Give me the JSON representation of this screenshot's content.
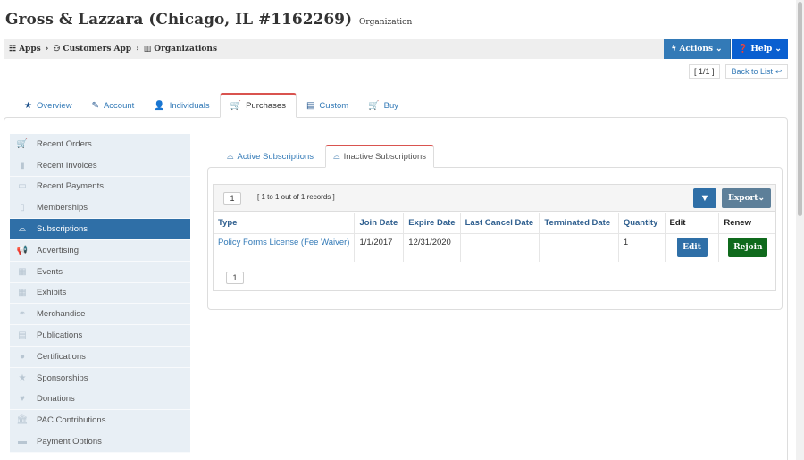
{
  "header": {
    "title": "Gross & Lazzara (Chicago, IL #1162269)",
    "subtitle": "Organization"
  },
  "breadcrumb": {
    "items": [
      {
        "label": "Apps",
        "icon": "grid-icon"
      },
      {
        "label": "Customers App",
        "icon": "users-icon"
      },
      {
        "label": "Organizations",
        "icon": "building-icon"
      }
    ],
    "separator": "›"
  },
  "toolbar": {
    "actions_label": "Actions",
    "help_label": "Help",
    "pager_label": "[ 1/1 ]",
    "back_label": "Back to List"
  },
  "main_tabs": [
    {
      "label": "Overview",
      "icon": "star-icon"
    },
    {
      "label": "Account",
      "icon": "edit-icon"
    },
    {
      "label": "Individuals",
      "icon": "user-icon"
    },
    {
      "label": "Purchases",
      "icon": "cart-icon"
    },
    {
      "label": "Custom",
      "icon": "file-icon"
    },
    {
      "label": "Buy",
      "icon": "cart-icon"
    }
  ],
  "sidebar": {
    "items": [
      {
        "label": "Recent Orders"
      },
      {
        "label": "Recent Invoices"
      },
      {
        "label": "Recent Payments"
      },
      {
        "label": "Memberships"
      },
      {
        "label": "Subscriptions"
      },
      {
        "label": "Advertising"
      },
      {
        "label": "Events"
      },
      {
        "label": "Exhibits"
      },
      {
        "label": "Merchandise"
      },
      {
        "label": "Publications"
      },
      {
        "label": "Certifications"
      },
      {
        "label": "Sponsorships"
      },
      {
        "label": "Donations"
      },
      {
        "label": "PAC Contributions"
      },
      {
        "label": "Payment Options"
      }
    ],
    "active": "Subscriptions"
  },
  "sub_tabs": [
    {
      "label": "Active Subscriptions"
    },
    {
      "label": "Inactive Subscriptions"
    }
  ],
  "grid": {
    "page": "1",
    "records_text": "[ 1 to 1 out of 1 records ]",
    "export_label": "Export",
    "bottom_page": "1",
    "columns": [
      "Type",
      "Join Date",
      "Expire Date",
      "Last Cancel Date",
      "Terminated Date",
      "Quantity",
      "Edit",
      "Renew"
    ],
    "rows": [
      {
        "type": "Policy Forms License (Fee Waiver)",
        "join_date": "1/1/2017",
        "expire_date": "12/31/2020",
        "last_cancel_date": "",
        "terminated_date": "",
        "quantity": "1",
        "edit_label": "Edit",
        "renew_label": "Rejoin"
      }
    ]
  },
  "colors": {
    "primary": "#337ab7",
    "help": "#0a5fd0",
    "active_tab_border": "#d9534f",
    "sidebar_active": "#2f6fa7",
    "rejoin": "#0f6a1c"
  }
}
